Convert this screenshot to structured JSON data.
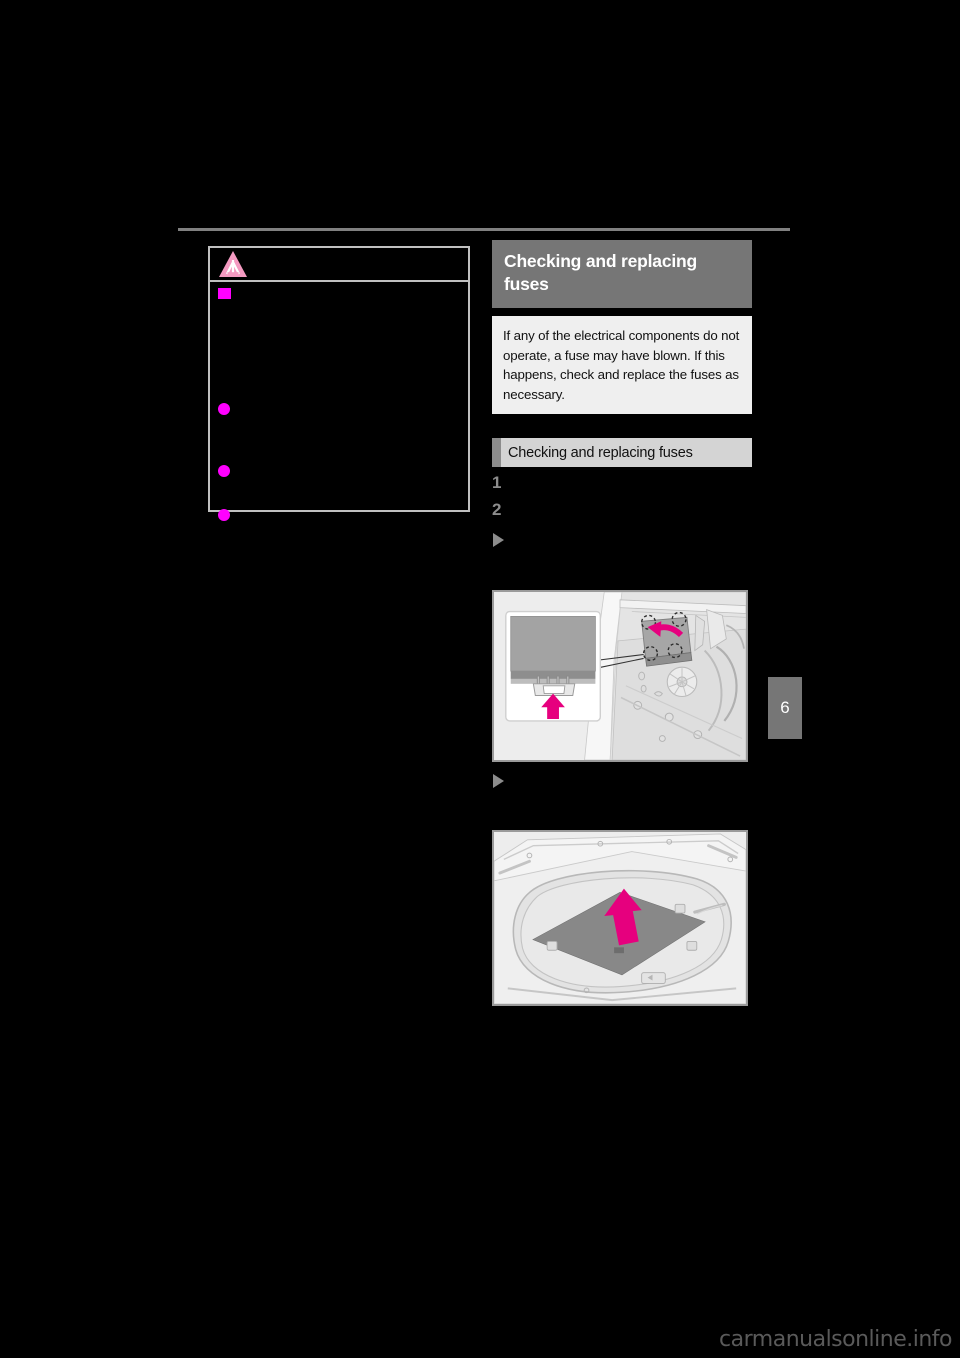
{
  "page": {
    "background_color": "#000000",
    "chapter_tab": "6",
    "watermark": "carmanualsonline.info"
  },
  "warning_box": {
    "icon": "warning-triangle-icon",
    "icon_color": "#f49ac1",
    "title": "",
    "square_bullet_text": "",
    "items": [
      {
        "bullet": "dot",
        "text": ""
      },
      {
        "bullet": "dot",
        "text": ""
      },
      {
        "bullet": "dot",
        "text": ""
      }
    ]
  },
  "section": {
    "header": "Checking and replacing fuses",
    "header_bg": "#767676",
    "intro": "If any of the electrical components do not operate, a fuse may have blown. If this happens, check and replace the fuses as necessary.",
    "intro_bg": "#efefef"
  },
  "subsection": {
    "label": "Checking and replacing fuses",
    "accent_color": "#8c8c8c",
    "bg": "#d4d4d4"
  },
  "steps": [
    {
      "number": "1",
      "text": ""
    },
    {
      "number": "2",
      "text": ""
    }
  ],
  "markers": [
    {
      "icon": "triangle-right-icon",
      "text": ""
    },
    {
      "icon": "triangle-right-icon",
      "text": ""
    }
  ],
  "figures": [
    {
      "name": "engine-compartment-fuse-box",
      "caption": "",
      "arrow_color": "#e6007e",
      "details": {
        "inset": "fuse-box-cover-clip-detail",
        "clip_markers": 4,
        "arrow_inset": "up-arrow",
        "arrow_main": "curved-arrow"
      }
    },
    {
      "name": "luggage-compartment-floor-panel",
      "caption": "",
      "arrow_color": "#e6007e",
      "details": {
        "arrow_main": "up-arrow"
      }
    }
  ]
}
